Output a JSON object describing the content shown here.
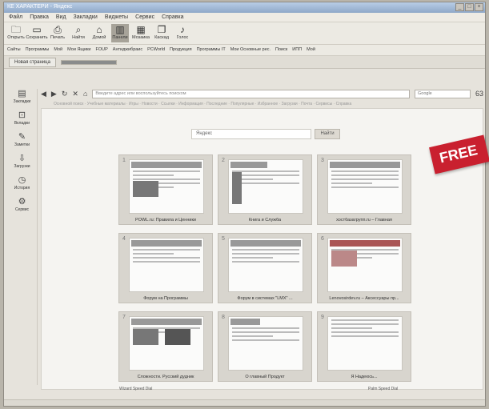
{
  "window": {
    "title": "КЕ ХАРАКТЕРИ - Яндекс",
    "controls": [
      "_",
      "□",
      "×"
    ]
  },
  "menu": [
    "Файл",
    "Правка",
    "Вид",
    "Закладки",
    "Виджеты",
    "Сервис",
    "Справка"
  ],
  "toolbar": [
    {
      "label": "Открыть",
      "icon": "folder-icon"
    },
    {
      "label": "Сохранить",
      "icon": "save-icon"
    },
    {
      "label": "Печать",
      "icon": "print-icon"
    },
    {
      "label": "Найти",
      "icon": "find-icon"
    },
    {
      "label": "Домой",
      "icon": "home-icon"
    },
    {
      "label": "Панели",
      "icon": "panels-icon"
    },
    {
      "label": "Мозаика",
      "icon": "grid-icon"
    },
    {
      "label": "Каскад",
      "icon": "cascade-icon"
    },
    {
      "label": "Голос",
      "icon": "voice-icon"
    }
  ],
  "bookmarks": [
    "Сайты",
    "Программы",
    "Мой",
    "Мои Ящики",
    "FOUP",
    "Антиджибраис",
    "PCWorld",
    "Продукция",
    "Программы IT",
    "Мои Основные рес.",
    "Поиск",
    "ИПП",
    "Мой"
  ],
  "tabs": [
    {
      "label": "Новая страница",
      "active": false
    },
    {
      "label": "",
      "active": true
    }
  ],
  "nav": {
    "url_placeholder": "Введите адрес или воспользуйтесь поиском",
    "search_placeholder": "Google",
    "extra": "63"
  },
  "subrow": "Основной поиск · Учебные материалы · Игры · Новости · Ссылки · Информация · Последние · Популярные · Избранное · Загрузки · Почта · Сервисы · Справка",
  "sidebar": [
    {
      "label": "Закладки",
      "icon": "bookmarks-icon"
    },
    {
      "label": "Вкладки",
      "icon": "tabs-icon"
    },
    {
      "label": "Заметки",
      "icon": "notes-icon"
    },
    {
      "label": "Загрузки",
      "icon": "download-icon"
    },
    {
      "label": "История",
      "icon": "history-icon"
    },
    {
      "label": "Сервис",
      "icon": "tools-icon"
    }
  ],
  "speed_search": {
    "placeholder": "Яндекс",
    "button": "Найти"
  },
  "tiles": [
    {
      "num": "1",
      "caption": "POWL.ru: Правила и Ценники"
    },
    {
      "num": "2",
      "caption": "Книга и Служба"
    },
    {
      "num": "3",
      "caption": "хостбазагрупп.ru – Главная"
    },
    {
      "num": "4",
      "caption": "Форум на Программы"
    },
    {
      "num": "5",
      "caption": "Форум в системах \"LMX\" ..."
    },
    {
      "num": "6",
      "caption": "Lenovosirdev.ru – Аксессуары пр..."
    },
    {
      "num": "7",
      "caption": "Сложности. Русский дудник"
    },
    {
      "num": "8",
      "caption": "О главный Продукт"
    },
    {
      "num": "9",
      "caption": "Я Надеюсь..."
    }
  ],
  "banner": "FREE",
  "footer_left": "Wizard Speed Dial",
  "footer_right": "Palm Speed Dial"
}
